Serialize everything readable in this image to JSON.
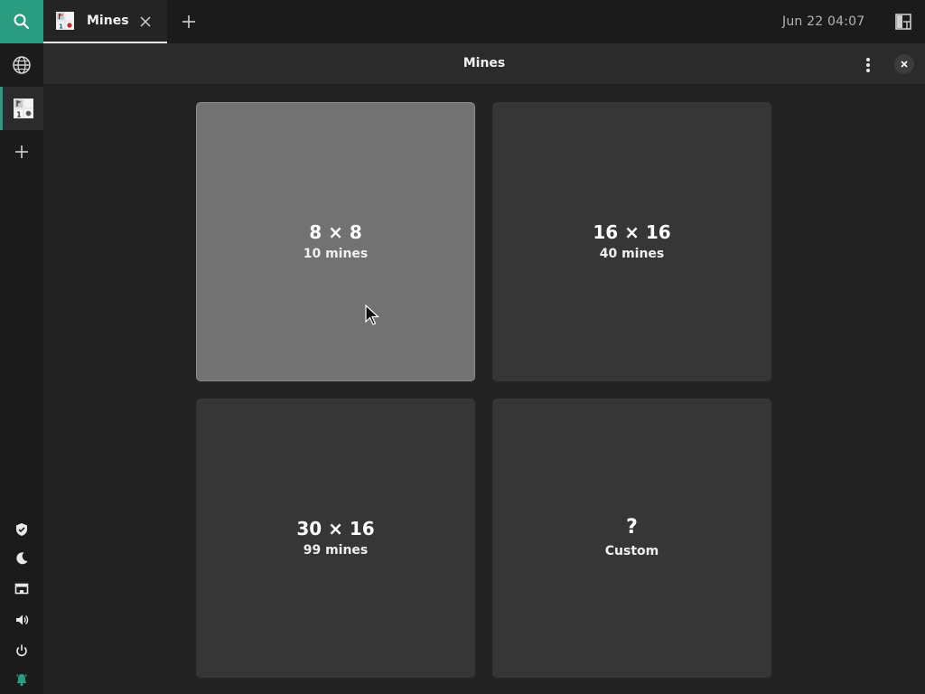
{
  "topbar": {
    "search_icon": "search-icon",
    "tab": {
      "label": "Mines",
      "icon": "mines-app-icon",
      "close_icon": "close-icon"
    },
    "new_tab_icon": "plus-icon",
    "clock": "Jun 22  04:07",
    "layout_icon": "window-layout-icon"
  },
  "sidebar": {
    "items": [
      "globe-icon",
      "mines-app-icon",
      "plus-icon"
    ],
    "tray": [
      "shield-icon",
      "moon-icon",
      "display-icon",
      "speaker-icon",
      "power-icon",
      "bell-icon"
    ]
  },
  "window": {
    "title": "Mines",
    "menu_icon": "kebab-menu-icon",
    "close_icon": "close-icon"
  },
  "cards": [
    {
      "size": "8 × 8",
      "mines": "10 mines"
    },
    {
      "size": "16 × 16",
      "mines": "40 mines"
    },
    {
      "size": "30 × 16",
      "mines": "99 mines"
    },
    {
      "symbol": "?",
      "label": "Custom"
    }
  ],
  "colors": {
    "accent": "#2a9d80",
    "card": "#363636",
    "card_hover": "#727272",
    "headerbar": "#2b2b2b",
    "background": "#232323"
  }
}
